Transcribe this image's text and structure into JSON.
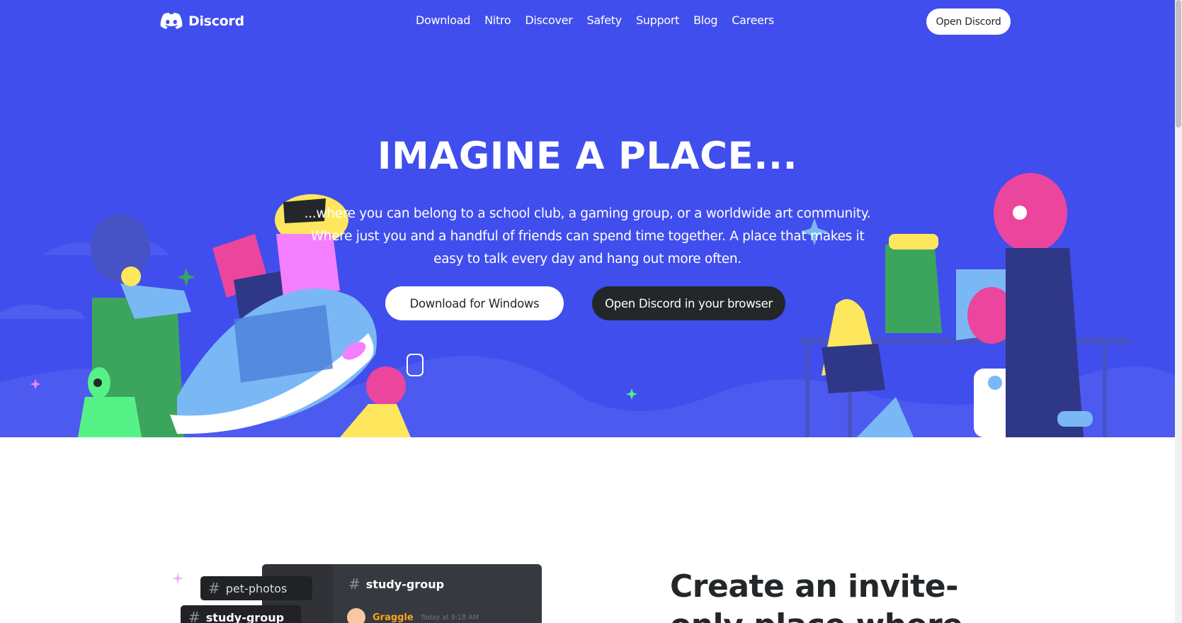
{
  "brand": {
    "name": "Discord",
    "accent": "#404eed",
    "dark": "#23272a"
  },
  "nav": {
    "links": [
      "Download",
      "Nitro",
      "Discover",
      "Safety",
      "Support",
      "Blog",
      "Careers"
    ],
    "open_label": "Open Discord"
  },
  "hero": {
    "title": "IMAGINE A PLACE...",
    "subtitle": "...where you can belong to a school club, a gaming group, or a worldwide art community. Where just you and a handful of friends can spend time together. A place that makes it easy to talk every day and hang out more often.",
    "download_label": "Download for Windows",
    "browser_label": "Open Discord in your browser"
  },
  "section": {
    "channels": [
      "pet-photos",
      "study-group"
    ],
    "panel_channel": "study-group",
    "message": {
      "author": "Graggle",
      "time": "Today at 9:18 AM"
    },
    "title": "Create an invite-only place where"
  },
  "icons": {
    "logo": "discord-logo-icon",
    "hash": "hash-icon"
  }
}
